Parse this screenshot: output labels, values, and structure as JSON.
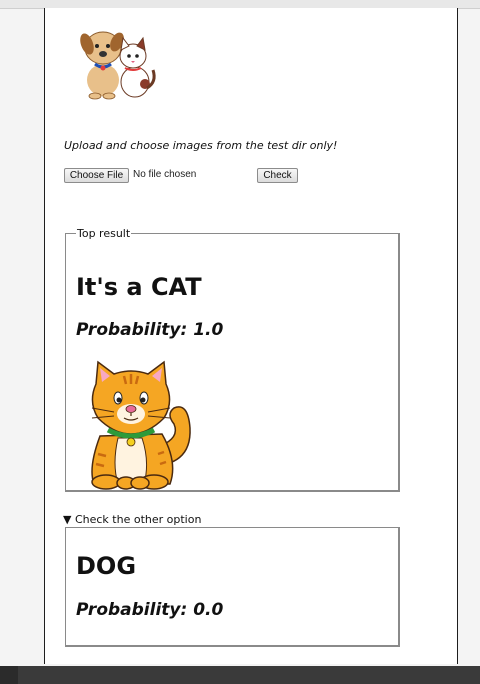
{
  "upload": {
    "instructions": "Upload and choose images from the test dir only!",
    "choose_file_label": "Choose File",
    "file_status": "No file chosen",
    "check_label": "Check"
  },
  "top_result": {
    "legend": "Top result",
    "heading": "It's a CAT",
    "probability": "Probability: 1.0"
  },
  "other_option": {
    "summary": "▼ Check the other option",
    "heading": "DOG",
    "probability": "Probability: 0.0"
  },
  "icons": {
    "logo": "cartoon-dog-and-cat-icon",
    "result_image": "cartoon-cat-icon"
  },
  "colors": {
    "cat_orange": "#f5a623",
    "background": "#ffffff"
  }
}
